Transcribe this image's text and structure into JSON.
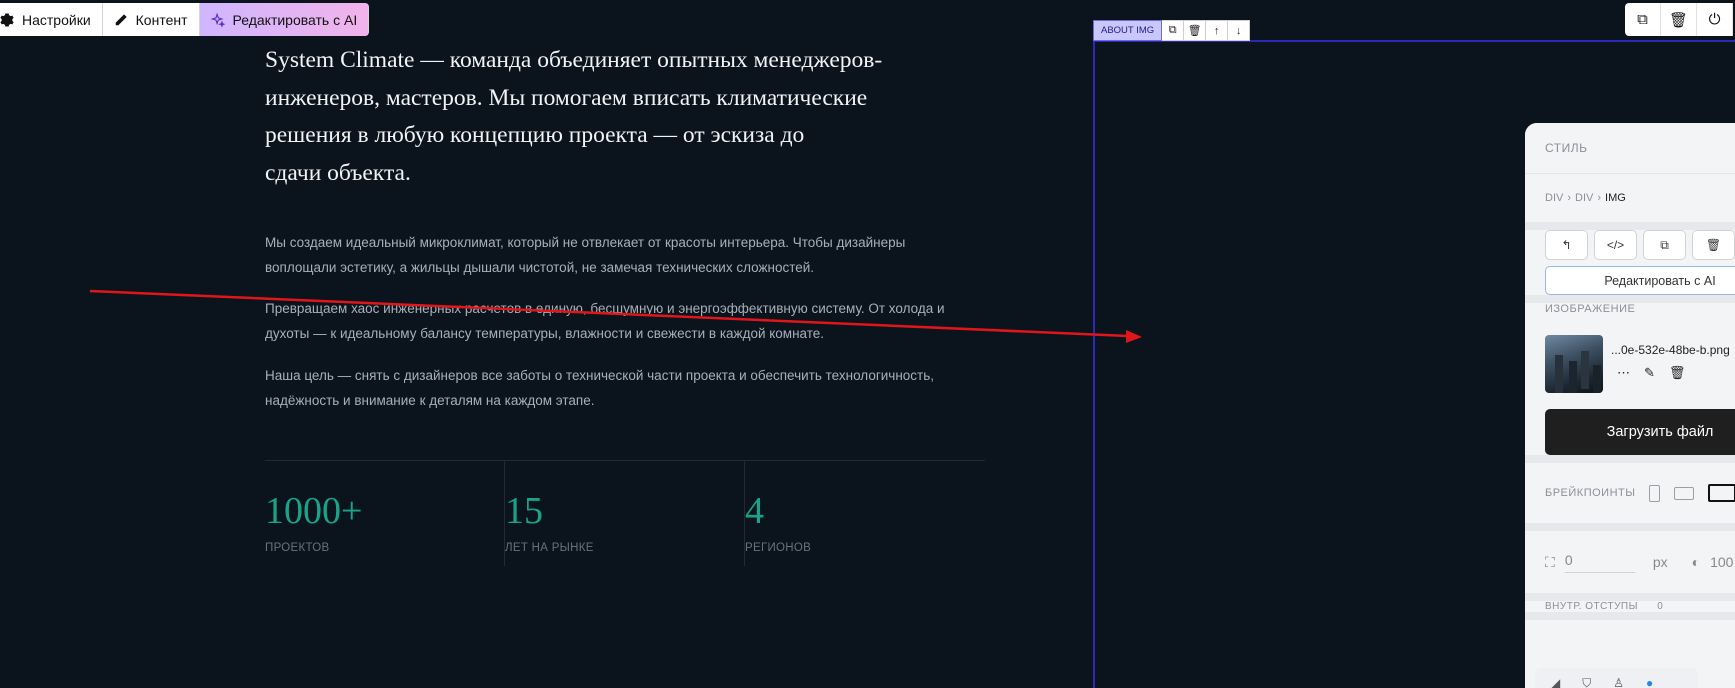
{
  "toolbar": {
    "settings_label": "Настройки",
    "content_label": "Контент",
    "ai_label": "Редактировать с AI"
  },
  "lead_lines": [
    "System Climate — команда объединяет опытных менеджеров-",
    "инженеров, мастеров. Мы помогаем вписать климатические",
    "решения в любую концепцию проекта — от эскиза до",
    "сдачи объекта."
  ],
  "paragraphs": [
    [
      "Мы создаем идеальный микроклимат, который не отвлекает от красоты интерьера. Чтобы дизайнеры",
      "воплощали эстетику, а жильцы дышали чистотой, не замечая технических сложностей."
    ],
    [
      "Превращаем хаос инженерных расчетов в единую, бесшумную и энергоэффективную систему. От холода и",
      "духоты — к идеальному балансу температуры, влажности и свежести в каждой комнате."
    ],
    [
      "Наша цель — снять с дизайнеров все заботы о технической части проекта и обеспечить технологичность,",
      "надёжность и внимание к деталям на каждом этапе."
    ]
  ],
  "stats": [
    {
      "value": "1000+",
      "label": "ПРОЕКТОВ"
    },
    {
      "value": "15",
      "label": "ЛЕТ НА РЫНКЕ"
    },
    {
      "value": "4",
      "label": "РЕГИОНОВ"
    }
  ],
  "selection": {
    "tag": "ABOUT IMG"
  },
  "panel": {
    "title": "СТИЛЬ",
    "breadcrumb": [
      "DIV",
      "DIV",
      "IMG"
    ],
    "ai_button": "Редактировать с AI",
    "image_label": "ИЗОБРАЖЕНИЕ",
    "file_name": "...0e-532e-48be-b.png",
    "upload_button": "Загрузить файл",
    "breakpoints_label": "БРЕЙКПОИНТЫ",
    "radius_value": "0",
    "unit": "px",
    "opacity_value": "100",
    "padding_label": "ВНУТР. ОТСТУПЫ",
    "padding_value": "0"
  },
  "colors": {
    "background": "#0b141d",
    "accent_green": "#1aa38a",
    "selection_blue": "#2c28b8",
    "arrow_red": "#e0161b"
  }
}
